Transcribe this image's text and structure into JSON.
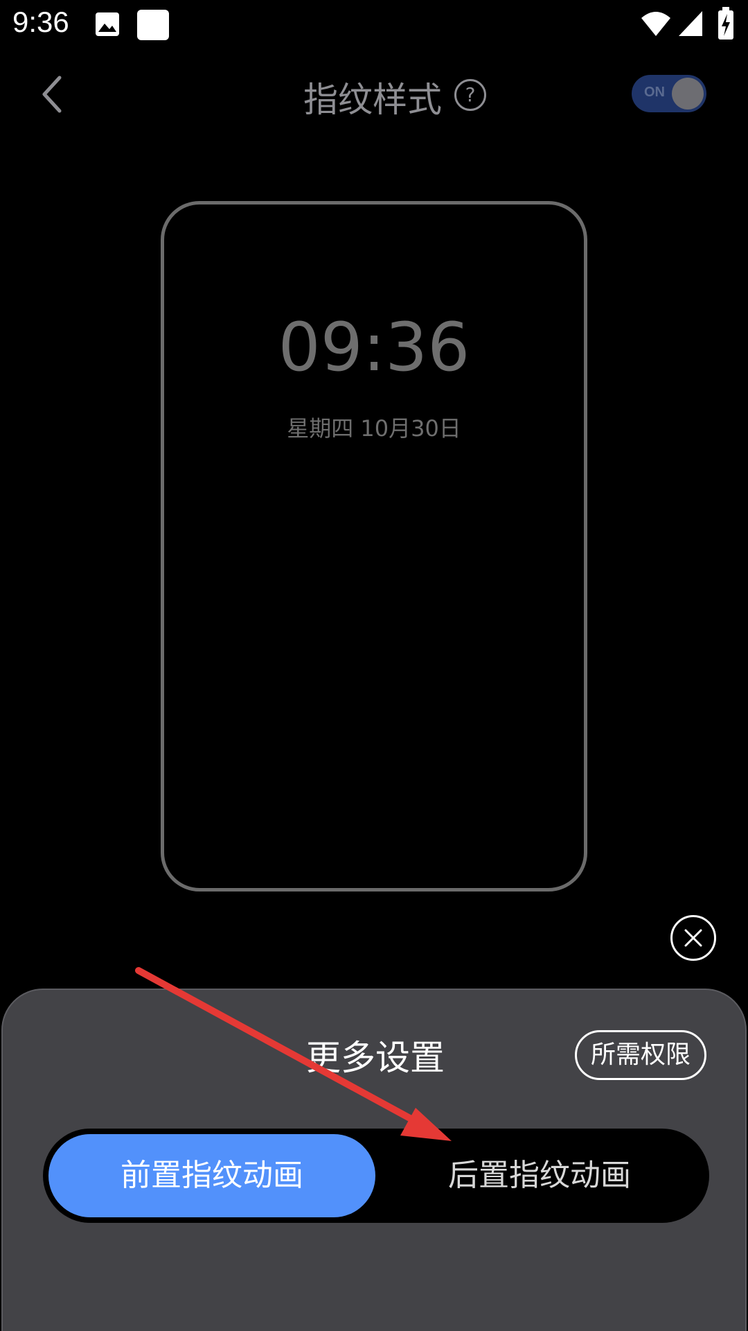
{
  "status_bar": {
    "time": "9:36",
    "icons": [
      "image-notification-icon",
      "square-notification-icon",
      "wifi-icon",
      "signal-icon",
      "battery-charging-icon"
    ]
  },
  "header": {
    "title": "指纹样式",
    "help_glyph": "?",
    "toggle_label": "ON",
    "toggle_state": "on"
  },
  "preview": {
    "clock": "09:36",
    "date": "星期四 10月30日"
  },
  "sheet": {
    "title": "更多设置",
    "permissions_label": "所需权限",
    "segments": [
      {
        "label": "前置指纹动画",
        "selected": true
      },
      {
        "label": "后置指纹动画",
        "selected": false
      }
    ]
  },
  "colors": {
    "background": "#000000",
    "sheet": "#434347",
    "accent": "#5291fb",
    "toggle_track": "#1f3468",
    "annotation": "#e53935"
  }
}
